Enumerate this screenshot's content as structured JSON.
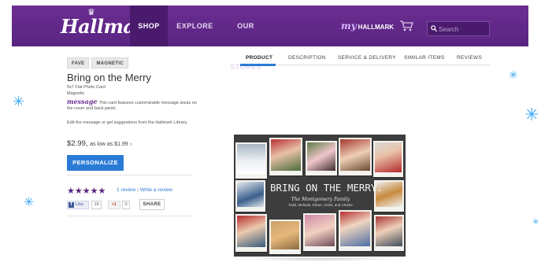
{
  "header": {
    "logo_text": "Hallmark",
    "nav": {
      "shop": "SHOP",
      "explore": "EXPLORE",
      "stores": "OUR STORES"
    },
    "my_label": "my",
    "hallmark_label": "HALLMARK",
    "search_placeholder": "Search"
  },
  "product": {
    "tags": [
      "FAVE",
      "MAGNETIC"
    ],
    "title": "Bring on the Merry",
    "subtitle": "5x7 Flat Photo Card",
    "feature": "Magnetic",
    "message_logo": "message",
    "message_text": "This card features customizable message areas on the cover and back panel.",
    "edit_text": "Edit the message or get suggestions from the Hallmark Library.",
    "price": "$2.99,",
    "price_low": "as low as $1.99",
    "price_chevron": "›",
    "personalize_label": "PERSONALIZE",
    "rating_stars": "★★★★★",
    "rating_value": 5,
    "review_count": "1 review",
    "review_sep": "|",
    "write_review": "Write a review",
    "fb_like": "Like",
    "fb_count": "19",
    "gplus_label": "+1",
    "gplus_count": "0",
    "share_label": "SHARE"
  },
  "tabs": [
    {
      "label": "PRODUCT",
      "active": true
    },
    {
      "label": "DESCRIPTION",
      "active": false
    },
    {
      "label": "SERVICE & DELIVERY",
      "active": false
    },
    {
      "label": "SIMILAR ITEMS",
      "active": false
    },
    {
      "label": "REVIEWS",
      "active": false
    }
  ],
  "card": {
    "title": "BRING ON THE MERRY.",
    "family": "The Montgomery Family",
    "names": "Todd, Melinda, Ethan, Violet, and Charlie"
  },
  "colors": {
    "header_purple": "#5a2482",
    "accent_blue": "#2a7bd6",
    "star_purple": "#5a2482",
    "snowflake": "#3fa9f5"
  }
}
